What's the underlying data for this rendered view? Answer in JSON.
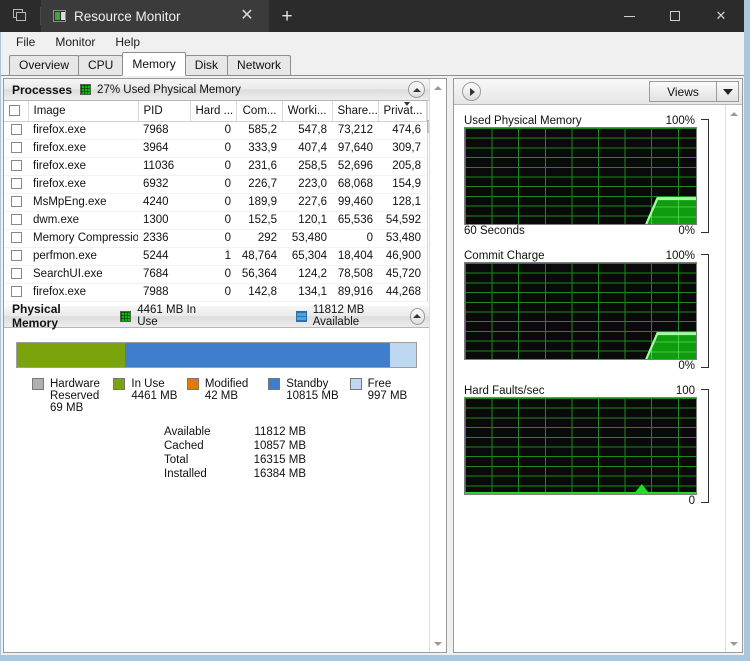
{
  "window": {
    "tab_title": "Resource Monitor",
    "new_tab_label": "+",
    "close_tab_label": "✕",
    "minimize_label": "—",
    "maximize_label": "□",
    "close_label": "✕"
  },
  "menubar": {
    "items": [
      "File",
      "Monitor",
      "Help"
    ]
  },
  "tabs": {
    "items": [
      "Overview",
      "CPU",
      "Memory",
      "Disk",
      "Network"
    ],
    "active": "Memory"
  },
  "processes": {
    "title": "Processes",
    "summary": "27% Used Physical Memory",
    "columns": [
      "Image",
      "PID",
      "Hard ...",
      "Com...",
      "Worki...",
      "Share...",
      "Privat..."
    ],
    "sorted_column": "Privat...",
    "rows": [
      {
        "image": "firefox.exe",
        "pid": "7968",
        "hard": "0",
        "commit": "585,2",
        "working": "547,8",
        "shareable": "73,212",
        "private": "474,6"
      },
      {
        "image": "firefox.exe",
        "pid": "3964",
        "hard": "0",
        "commit": "333,9",
        "working": "407,4",
        "shareable": "97,640",
        "private": "309,7"
      },
      {
        "image": "firefox.exe",
        "pid": "11036",
        "hard": "0",
        "commit": "231,6",
        "working": "258,5",
        "shareable": "52,696",
        "private": "205,8"
      },
      {
        "image": "firefox.exe",
        "pid": "6932",
        "hard": "0",
        "commit": "226,7",
        "working": "223,0",
        "shareable": "68,068",
        "private": "154,9"
      },
      {
        "image": "MsMpEng.exe",
        "pid": "4240",
        "hard": "0",
        "commit": "189,9",
        "working": "227,6",
        "shareable": "99,460",
        "private": "128,1"
      },
      {
        "image": "dwm.exe",
        "pid": "1300",
        "hard": "0",
        "commit": "152,5",
        "working": "120,1",
        "shareable": "65,536",
        "private": "54,592"
      },
      {
        "image": "Memory Compression",
        "pid": "2336",
        "hard": "0",
        "commit": "292",
        "working": "53,480",
        "shareable": "0",
        "private": "53,480"
      },
      {
        "image": "perfmon.exe",
        "pid": "5244",
        "hard": "1",
        "commit": "48,764",
        "working": "65,304",
        "shareable": "18,404",
        "private": "46,900"
      },
      {
        "image": "SearchUI.exe",
        "pid": "7684",
        "hard": "0",
        "commit": "56,364",
        "working": "124,2",
        "shareable": "78,508",
        "private": "45,720"
      },
      {
        "image": "firefox.exe",
        "pid": "7988",
        "hard": "0",
        "commit": "142,8",
        "working": "134,1",
        "shareable": "89,916",
        "private": "44,268"
      }
    ]
  },
  "physical_memory": {
    "title": "Physical Memory",
    "in_use_label": "4461 MB In Use",
    "available_label": "11812 MB Available",
    "bar": [
      {
        "name": "In Use",
        "percent": 27.0,
        "color": "#7aa30c"
      },
      {
        "name": "Standby",
        "percent": 66.5,
        "color": "#3d7fcc"
      },
      {
        "name": "Free",
        "percent": 6.5,
        "color": "#bdd8f0"
      }
    ],
    "legend": [
      {
        "label": "Hardware",
        "label2": "Reserved",
        "value": "69 MB",
        "color": "#b0b0b0"
      },
      {
        "label": "In Use",
        "label2": "",
        "value": "4461 MB",
        "color": "#7aa30c"
      },
      {
        "label": "Modified",
        "label2": "",
        "value": "42 MB",
        "color": "#e07b00"
      },
      {
        "label": "Standby",
        "label2": "",
        "value": "10815 MB",
        "color": "#3d7fcc"
      },
      {
        "label": "Free",
        "label2": "",
        "value": "997 MB",
        "color": "#bdd8f0"
      }
    ],
    "stats": [
      {
        "key": "Available",
        "value": "11812 MB"
      },
      {
        "key": "Cached",
        "value": "10857 MB"
      },
      {
        "key": "Total",
        "value": "16315 MB"
      },
      {
        "key": "Installed",
        "value": "16384 MB"
      }
    ]
  },
  "views": {
    "button_label": "Views"
  },
  "graphs": [
    {
      "title": "Used Physical Memory",
      "max_label": "100%",
      "min_label": "0%",
      "x_label": "60 Seconds",
      "type": "area"
    },
    {
      "title": "Commit Charge",
      "max_label": "100%",
      "min_label": "0%",
      "x_label": "",
      "type": "area"
    },
    {
      "title": "Hard Faults/sec",
      "max_label": "100",
      "min_label": "0",
      "x_label": "",
      "type": "spike"
    }
  ]
}
